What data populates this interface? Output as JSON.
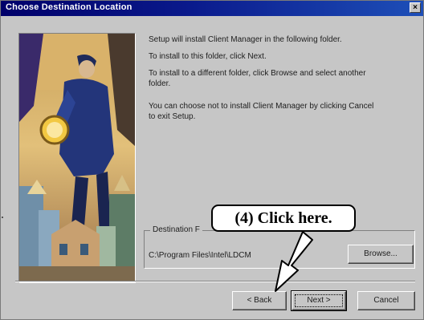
{
  "window": {
    "title": "Choose Destination Location",
    "close_label": "×"
  },
  "messages": {
    "line1": "Setup will install Client Manager in the following folder.",
    "line2": "To install to this folder, click Next.",
    "line3a": "To install to a different folder, click Browse and select another",
    "line3b": "folder.",
    "line4a": "You can choose not to install Client Manager by clicking Cancel",
    "line4b": "to exit Setup."
  },
  "destination": {
    "label": "Destination F",
    "path": "C:\\Program Files\\Intel\\LDCM",
    "browse_label": "Browse..."
  },
  "buttons": {
    "back_label": "< Back",
    "next_label": "Next >",
    "cancel_label": "Cancel"
  },
  "annotation": {
    "callout_text": "(4)  Click here."
  },
  "colors": {
    "titlebar_start": "#00006a",
    "titlebar_end": "#1e4fb8",
    "dialog_bg": "#c6c6c6"
  }
}
